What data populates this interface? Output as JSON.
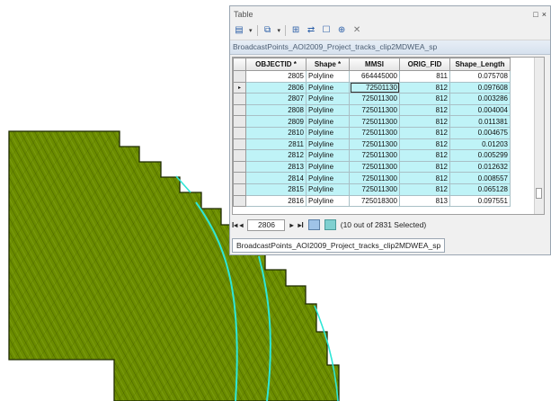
{
  "window": {
    "title": "Table",
    "controls": {
      "pin": "□",
      "close": "×"
    }
  },
  "toolbar": {
    "icons": [
      "table-options-icon",
      "related-tables-icon",
      "select-by-attributes-icon",
      "switch-selection-icon",
      "clear-selection-icon",
      "zoom-to-selected-icon",
      "delete-selected-icon"
    ]
  },
  "table_name": "BroadcastPoints_AOI2009_Project_tracks_clip2MDWEA_sp",
  "columns": [
    "OBJECTID *",
    "Shape *",
    "MMSI",
    "ORIG_FID",
    "Shape_Length"
  ],
  "rows": [
    [
      "2805",
      "Polyline",
      "664445000",
      "811",
      "0.075708"
    ],
    [
      "2806",
      "Polyline",
      "72501130",
      "812",
      "0.097608"
    ],
    [
      "2807",
      "Polyline",
      "725011300",
      "812",
      "0.003286"
    ],
    [
      "2808",
      "Polyline",
      "725011300",
      "812",
      "0.004004"
    ],
    [
      "2809",
      "Polyline",
      "725011300",
      "812",
      "0.011381"
    ],
    [
      "2810",
      "Polyline",
      "725011300",
      "812",
      "0.004675"
    ],
    [
      "2811",
      "Polyline",
      "725011300",
      "812",
      "0.01203"
    ],
    [
      "2812",
      "Polyline",
      "725011300",
      "812",
      "0.005299"
    ],
    [
      "2813",
      "Polyline",
      "725011300",
      "812",
      "0.012632"
    ],
    [
      "2814",
      "Polyline",
      "725011300",
      "812",
      "0.008557"
    ],
    [
      "2815",
      "Polyline",
      "725011300",
      "812",
      "0.065128"
    ],
    [
      "2816",
      "Polyline",
      "725018300",
      "813",
      "0.097551"
    ]
  ],
  "navigation": {
    "first": "I◂ ◂",
    "record": "2806",
    "next": "▸",
    "last": "▸I",
    "selection_status": "(10 out of 2831 Selected)"
  },
  "tab_label": "BroadcastPoints_AOI2009_Project_tracks_clip2MDWEA_sp",
  "colors": {
    "map_fill": "#6b8c00",
    "map_hatch": "#4a6500",
    "track_line": "#2ee6d6",
    "selected_row": "#bff3f7"
  }
}
